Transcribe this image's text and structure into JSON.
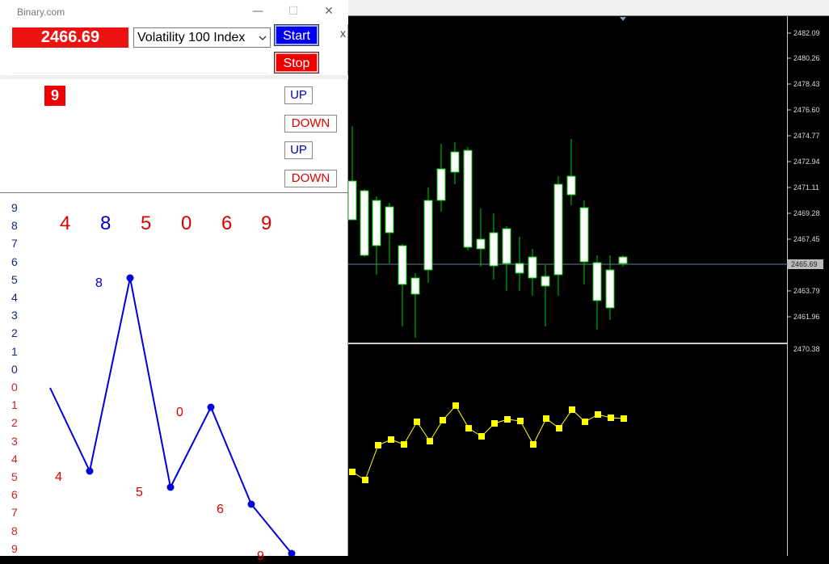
{
  "window": {
    "title": "Binary.com",
    "minimize_icon": "minimize-icon",
    "maximize_icon": "maximize-icon",
    "close_icon": "close-icon",
    "minimize_glyph": "—",
    "maximize_glyph": "☐",
    "close_glyph": "✕"
  },
  "controls": {
    "price": "2466.69",
    "symbol_selected": "Volatility 100 Index",
    "start_label": "Start",
    "stop_label": "Stop",
    "small_close": "x",
    "last_digit": "9",
    "accent_price_color": "#ee1111",
    "start_color": "#0000ee",
    "stop_color": "#ee0000"
  },
  "signals": [
    {
      "label": "UP",
      "type": "up"
    },
    {
      "label": "DOWN",
      "type": "down"
    },
    {
      "label": "UP",
      "type": "up"
    },
    {
      "label": "DOWN",
      "type": "down"
    }
  ],
  "digit_scale": {
    "upper": [
      "9",
      "8",
      "7",
      "6",
      "5",
      "4",
      "3",
      "2",
      "1",
      "0"
    ],
    "lower": [
      "0",
      "1",
      "2",
      "3",
      "4",
      "5",
      "6",
      "7",
      "8",
      "9"
    ],
    "upper_color": "#1a237e",
    "lower_color": "#cc2222"
  },
  "digit_history": [
    {
      "digit": "4",
      "color": "#dd0000"
    },
    {
      "digit": "8",
      "color": "#0000cc"
    },
    {
      "digit": "5",
      "color": "#dd0000"
    },
    {
      "digit": "0",
      "color": "#dd0000"
    },
    {
      "digit": "6",
      "color": "#dd0000"
    },
    {
      "digit": "9",
      "color": "#dd0000"
    }
  ],
  "digit_points": [
    {
      "label": "4",
      "color": "#dd0000"
    },
    {
      "label": "8",
      "color": "#0000cc"
    },
    {
      "label": "5",
      "color": "#dd0000"
    },
    {
      "label": "0",
      "color": "#dd0000"
    },
    {
      "label": "6",
      "color": "#dd0000"
    },
    {
      "label": "9",
      "color": "#dd0000"
    }
  ],
  "price_axis": [
    "2482.09",
    "2480.26",
    "2478.43",
    "2476.60",
    "2474.77",
    "2472.94",
    "2471.11",
    "2469.28",
    "2467.45",
    "2465.69",
    "2463.79",
    "2461.96"
  ],
  "current_price_tag": "2465.69",
  "indicator_axis": [
    "2470.38"
  ],
  "chart_colors": {
    "background": "#000000",
    "candle_up": "#ffffff",
    "candle_border": "#00cc00",
    "indicator": "#ffff00"
  }
}
